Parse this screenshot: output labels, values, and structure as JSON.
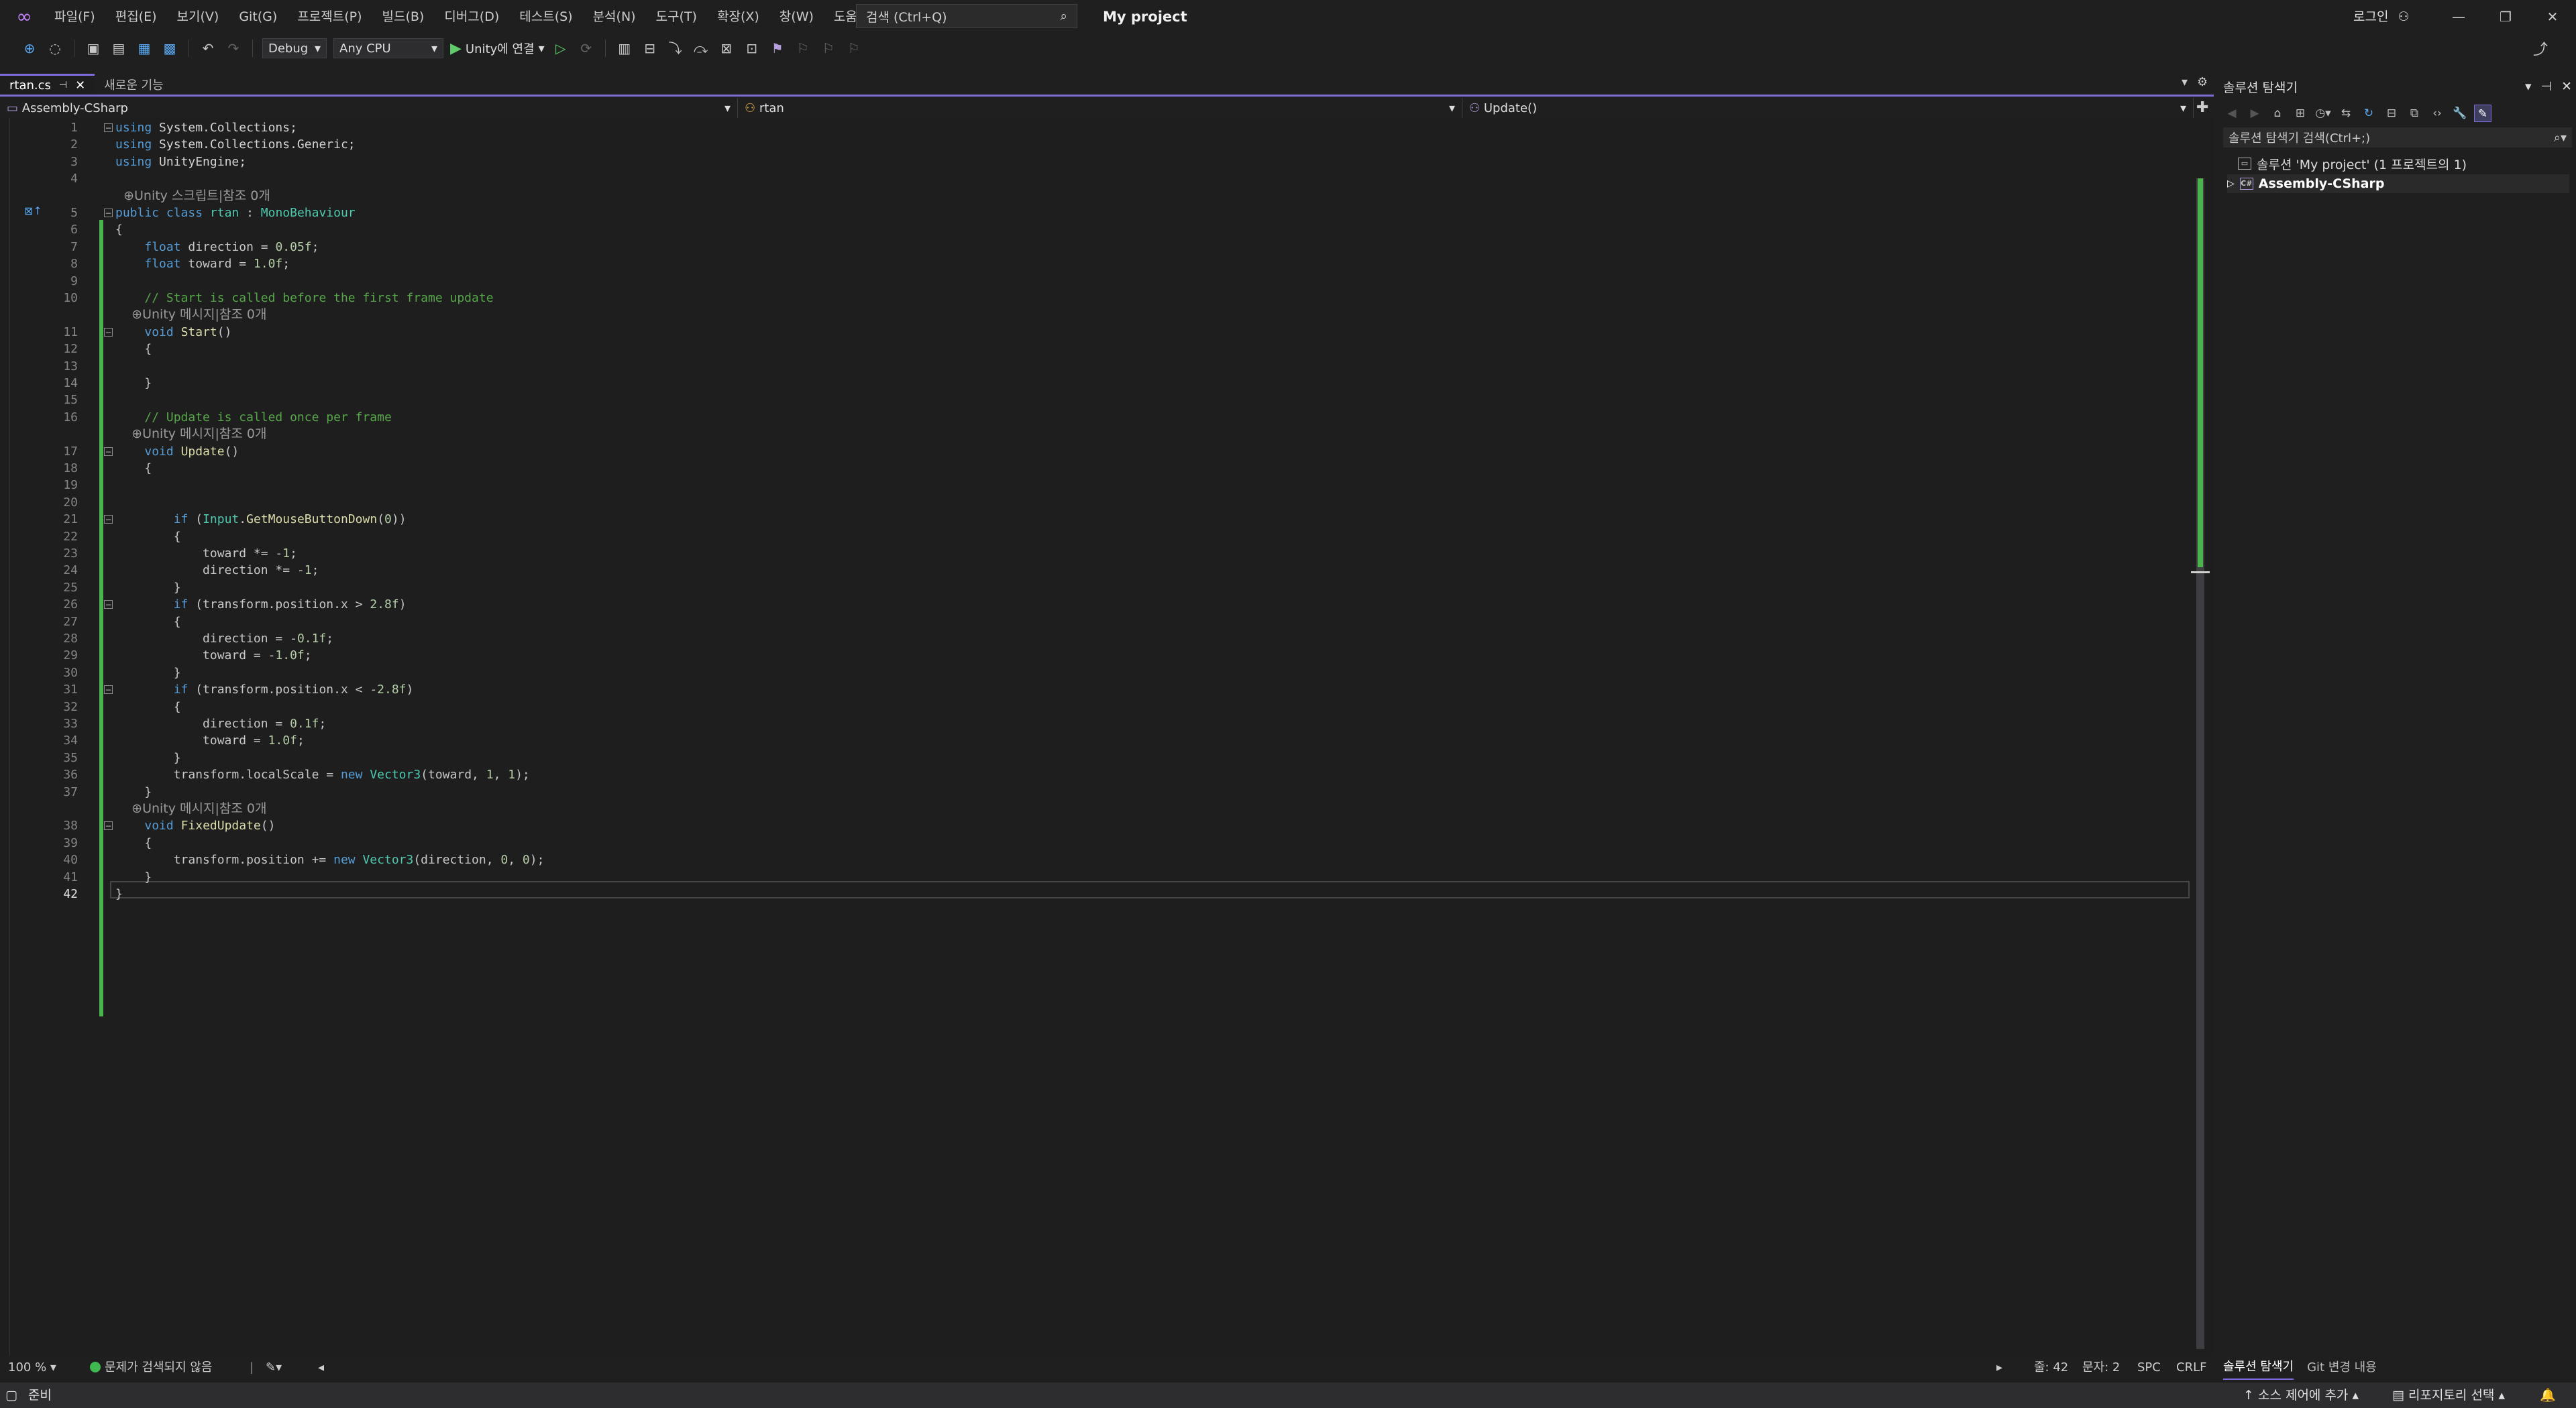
{
  "window": {
    "project_title": "My project",
    "login_label": "로그인",
    "controls": [
      "—",
      "❐",
      "✕"
    ]
  },
  "menu": [
    "파일(F)",
    "편집(E)",
    "보기(V)",
    "Git(G)",
    "프로젝트(P)",
    "빌드(B)",
    "디버그(D)",
    "테스트(S)",
    "분석(N)",
    "도구(T)",
    "확장(X)",
    "창(W)",
    "도움말(H)"
  ],
  "search": {
    "placeholder": "검색 (Ctrl+Q)"
  },
  "toolbar": {
    "config": "Debug",
    "platform": "Any CPU",
    "run_label": "Unity에 연결"
  },
  "tabs": [
    {
      "label": "rtan.cs",
      "active": true
    },
    {
      "label": "새로운 기능",
      "active": false
    }
  ],
  "nav": {
    "project": "Assembly-CSharp",
    "class": "rtan",
    "member": "Update()"
  },
  "code_lines": [
    {
      "n": "1",
      "fold": true,
      "html": "<span class=\"kw\">using</span> <span class=\"ns\">System.Collections;</span>"
    },
    {
      "n": "2",
      "html": "<span class=\"kw\">using</span> <span class=\"ns\">System.Collections.Generic;</span>"
    },
    {
      "n": "3",
      "html": "<span class=\"kw\">using</span> <span class=\"ns\">UnityEngine;</span>"
    },
    {
      "n": "4",
      "html": ""
    },
    {
      "n": "",
      "lens": true,
      "html": "  ⊕Unity 스크립트|참조 0개"
    },
    {
      "n": "5",
      "fold": true,
      "marker": true,
      "html": "<span class=\"kw\">public class</span> <span class=\"ty\">rtan</span> : <span class=\"ty\">MonoBehaviour</span>"
    },
    {
      "n": "6",
      "html": "{"
    },
    {
      "n": "7",
      "html": "    <span class=\"kw\">float</span> direction = <span class=\"num\">0.05f</span>;"
    },
    {
      "n": "8",
      "html": "    <span class=\"kw\">float</span> toward = <span class=\"num\">1.0f</span>;"
    },
    {
      "n": "9",
      "html": ""
    },
    {
      "n": "10",
      "html": "    <span class=\"cm\">// Start is called before the first frame update</span>"
    },
    {
      "n": "",
      "lens": true,
      "html": "    ⊕Unity 메시지|참조 0개"
    },
    {
      "n": "11",
      "fold": true,
      "html": "    <span class=\"kw\">void</span> <span class=\"fn\">Start</span>()"
    },
    {
      "n": "12",
      "html": "    {"
    },
    {
      "n": "13",
      "html": ""
    },
    {
      "n": "14",
      "html": "    }"
    },
    {
      "n": "15",
      "html": ""
    },
    {
      "n": "16",
      "html": "    <span class=\"cm\">// Update is called once per frame</span>"
    },
    {
      "n": "",
      "lens": true,
      "html": "    ⊕Unity 메시지|참조 0개"
    },
    {
      "n": "17",
      "fold": true,
      "html": "    <span class=\"kw\">void</span> <span class=\"fn\">Update</span>()"
    },
    {
      "n": "18",
      "html": "    {"
    },
    {
      "n": "19",
      "html": ""
    },
    {
      "n": "20",
      "html": ""
    },
    {
      "n": "21",
      "fold": true,
      "html": "        <span class=\"kw\">if</span> (<span class=\"ty\">Input</span>.<span class=\"fn\">GetMouseButtonDown</span>(<span class=\"num\">0</span>))"
    },
    {
      "n": "22",
      "html": "        {"
    },
    {
      "n": "23",
      "html": "            toward *= -<span class=\"num\">1</span>;"
    },
    {
      "n": "24",
      "html": "            direction *= -<span class=\"num\">1</span>;"
    },
    {
      "n": "25",
      "html": "        }"
    },
    {
      "n": "26",
      "fold": true,
      "html": "        <span class=\"kw\">if</span> (transform.position.x > <span class=\"num\">2.8f</span>)"
    },
    {
      "n": "27",
      "html": "        {"
    },
    {
      "n": "28",
      "html": "            direction = -<span class=\"num\">0.1f</span>;"
    },
    {
      "n": "29",
      "html": "            toward = -<span class=\"num\">1.0f</span>;"
    },
    {
      "n": "30",
      "html": "        }"
    },
    {
      "n": "31",
      "fold": true,
      "html": "        <span class=\"kw\">if</span> (transform.position.x < -<span class=\"num\">2.8f</span>)"
    },
    {
      "n": "32",
      "html": "        {"
    },
    {
      "n": "33",
      "html": "            direction = <span class=\"num\">0.1f</span>;"
    },
    {
      "n": "34",
      "html": "            toward = <span class=\"num\">1.0f</span>;"
    },
    {
      "n": "35",
      "html": "        }"
    },
    {
      "n": "36",
      "html": "        transform.localScale = <span class=\"kw\">new</span> <span class=\"ty\">Vector3</span>(toward, <span class=\"num\">1</span>, <span class=\"num\">1</span>);"
    },
    {
      "n": "37",
      "html": "    }"
    },
    {
      "n": "",
      "lens": true,
      "html": "    ⊕Unity 메시지|참조 0개"
    },
    {
      "n": "38",
      "fold": true,
      "html": "    <span class=\"kw\">void</span> <span class=\"fn\">FixedUpdate</span>()"
    },
    {
      "n": "39",
      "html": "    {"
    },
    {
      "n": "40",
      "html": "        transform.position += <span class=\"kw\">new</span> <span class=\"ty\">Vector3</span>(direction, <span class=\"num\">0</span>, <span class=\"num\">0</span>);"
    },
    {
      "n": "41",
      "html": "    }"
    },
    {
      "n": "42",
      "active": true,
      "html": "}"
    }
  ],
  "editor_status": {
    "zoom": "100 %",
    "issues": "문제가 검색되지 않음",
    "line": "줄: 42",
    "char": "문자: 2",
    "spc": "SPC",
    "crlf": "CRLF"
  },
  "solution": {
    "title": "솔루션 탐색기",
    "search_placeholder": "솔루션 탐색기 검색(Ctrl+;)",
    "root": "솔루션 'My project' (1 프로젝트의 1)",
    "project": "Assembly-CSharp",
    "tabs": [
      "솔루션 탐색기",
      "Git 변경 내용"
    ]
  },
  "statusbar": {
    "ready": "준비",
    "source_control": "소스 제어에 추가",
    "repo": "리포지토리 선택"
  },
  "colors": {
    "accent": "#7d6cd9",
    "change_bar": "#4bb34b",
    "background": "#1f1f1f"
  }
}
